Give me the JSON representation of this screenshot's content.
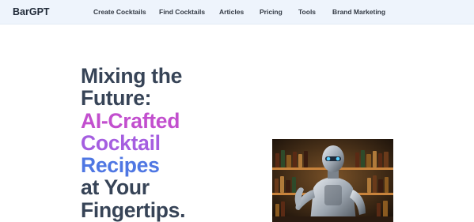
{
  "nav": {
    "brand": "BarGPT",
    "links": [
      "Create Cocktails",
      "Find Cocktails",
      "Articles",
      "Pricing",
      "Tools",
      "Brand Marketing"
    ]
  },
  "hero": {
    "line1": "Mixing the",
    "line2": "Future:",
    "line3": "AI-Crafted",
    "line4": "Cocktail",
    "line5": "Recipes",
    "line6": "at Your",
    "line7": "Fingertips."
  },
  "colors": {
    "nav_bg": "#eef4fc",
    "heading_dark": "#374457",
    "gradient_pink": "#c24fce",
    "gradient_violet": "#a55ee0",
    "gradient_blue": "#4f77e3"
  },
  "image": {
    "subject": "robot-bartender-icon"
  }
}
